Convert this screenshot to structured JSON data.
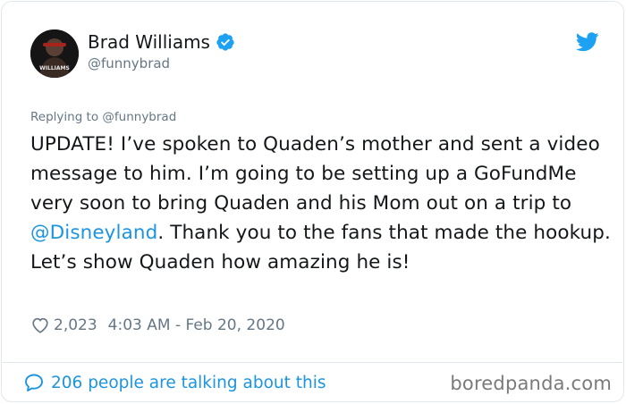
{
  "author": {
    "display_name": "Brad Williams",
    "handle": "@funnybrad",
    "avatar_caption": "WILLIAMS",
    "verified": true
  },
  "icons": {
    "verified": "verified-badge-icon",
    "platform": "twitter-bird-icon",
    "like": "heart-icon",
    "conversation": "speech-bubble-icon"
  },
  "colors": {
    "link_blue": "#1b95e0",
    "secondary_gray": "#657786",
    "divider": "#e1e8ed"
  },
  "tweet": {
    "replying_to": "Replying to @funnybrad",
    "text_before_mention": "UPDATE! I’ve spoken to Quaden’s mother and sent a video message to him. I’m going to be setting up a GoFundMe very soon to bring Quaden and his Mom out on a trip to ",
    "mention": "@Disneyland",
    "text_after_mention": ". Thank you to the fans that made the hookup. Let’s show Quaden how amazing he is!",
    "like_count": "2,023",
    "timestamp": "4:03 AM - Feb 20, 2020"
  },
  "footer": {
    "talking_label": "206 people are talking about this"
  },
  "watermark": "boredpanda.com"
}
